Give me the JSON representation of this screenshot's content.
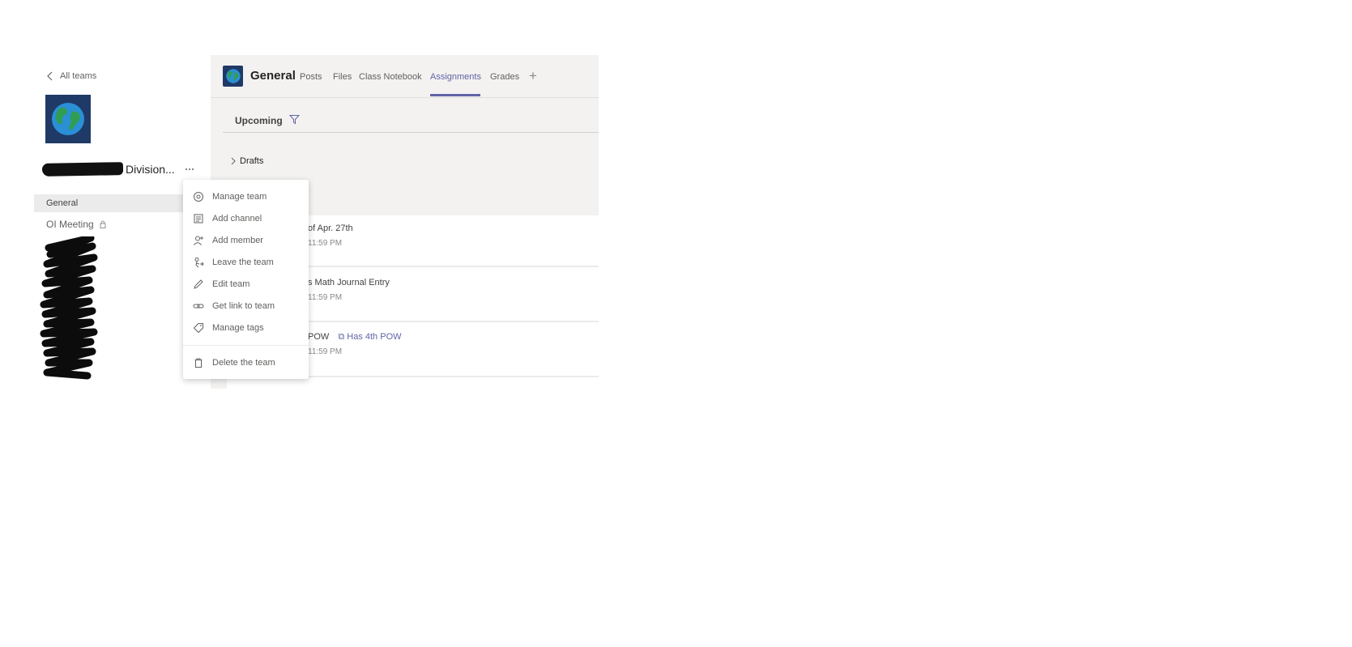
{
  "sidebar": {
    "back_label": "All teams",
    "team_name": "Division...",
    "channels": [
      {
        "label": "General"
      },
      {
        "label": "OI Meeting"
      }
    ]
  },
  "header": {
    "channel_title": "General",
    "tabs": [
      {
        "label": "Posts"
      },
      {
        "label": "Files"
      },
      {
        "label": "Class Notebook"
      },
      {
        "label": "Assignments"
      },
      {
        "label": "Grades"
      }
    ],
    "add_tab": "+"
  },
  "assignments": {
    "section_label": "Upcoming",
    "drafts_label": "Drafts",
    "items": [
      {
        "title": "of Apr. 27th",
        "due": "11:59 PM",
        "tag": ""
      },
      {
        "title": "s Math Journal Entry",
        "due": "11:59 PM",
        "tag": ""
      },
      {
        "title": "POW",
        "due": "11:59 PM",
        "tag": "Has 4th POW"
      }
    ]
  },
  "context_menu": {
    "items": [
      {
        "label": "Manage team",
        "icon": "gear-icon"
      },
      {
        "label": "Add channel",
        "icon": "channel-icon"
      },
      {
        "label": "Add member",
        "icon": "add-person-icon"
      },
      {
        "label": "Leave the team",
        "icon": "leave-icon"
      },
      {
        "label": "Edit team",
        "icon": "pencil-icon"
      },
      {
        "label": "Get link to team",
        "icon": "link-icon"
      },
      {
        "label": "Manage tags",
        "icon": "tag-icon"
      },
      {
        "label": "Delete the team",
        "icon": "trash-icon"
      }
    ]
  },
  "colors": {
    "accent": "#6264a7",
    "team_avatar_bg": "#1f3a66",
    "globe_water": "#2b8fd6",
    "globe_land": "#2f9e52"
  }
}
